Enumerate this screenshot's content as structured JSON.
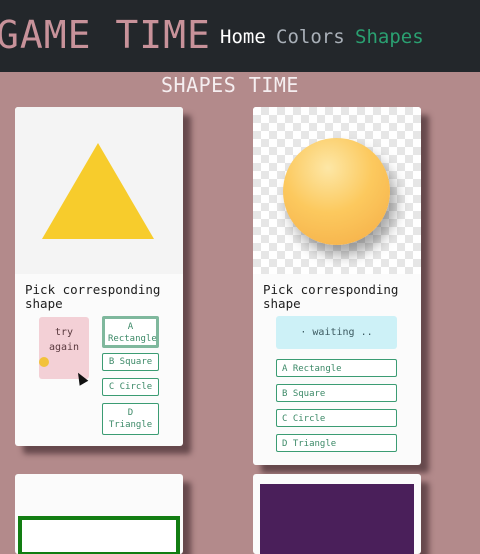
{
  "navbar": {
    "brand": "GAME TIME",
    "links": [
      {
        "label": "Home",
        "state": "default"
      },
      {
        "label": "Colors",
        "state": "muted"
      },
      {
        "label": "Shapes",
        "state": "active"
      }
    ]
  },
  "page": {
    "title": "SHAPES TIME"
  },
  "cards": [
    {
      "image": "yellow-triangle",
      "prompt": "Pick corresponding shape",
      "feedback": {
        "line1": "try",
        "line2": "again",
        "emoji": "smiley"
      },
      "options": [
        "A Rectangle",
        "B Square",
        "C Circle",
        "D Triangle"
      ],
      "selected": "A Rectangle"
    },
    {
      "image": "orange-sphere",
      "prompt": "Pick corresponding shape",
      "feedback": {
        "text": "· waiting .."
      },
      "options": [
        "A Rectangle",
        "B Square",
        "C Circle",
        "D Triangle"
      ]
    }
  ],
  "colors": {
    "background": "#b38a8b",
    "navbar": "#23272b",
    "brand": "#c8929a",
    "active_link": "#2aa071",
    "option_border": "#3b9c73",
    "error_feedback": "#f3d0d6",
    "waiting_feedback": "#cdf1f7"
  }
}
